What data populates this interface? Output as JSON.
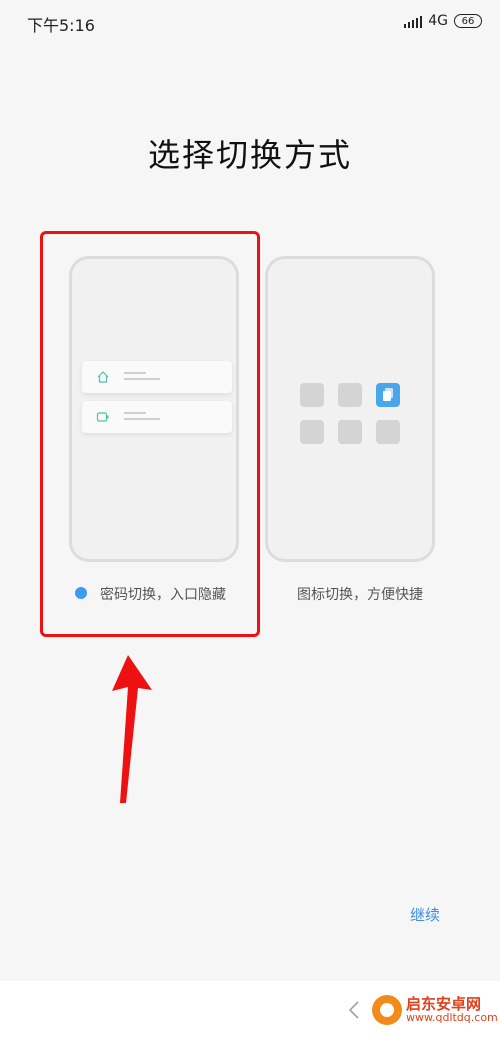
{
  "status_bar": {
    "time": "下午5:16",
    "network": "4G",
    "battery": "66"
  },
  "page": {
    "title": "选择切换方式"
  },
  "options": [
    {
      "label": "密码切换，入口隐藏",
      "selected": true
    },
    {
      "label": "图标切换，方便快捷",
      "selected": false
    }
  ],
  "actions": {
    "continue_label": "继续"
  },
  "watermark": {
    "name": "启东安卓网",
    "url": "www.qdltdq.com"
  },
  "colors": {
    "accent": "#3a9cf0",
    "highlight": "#ee1111",
    "active_tile": "#4aa6ea"
  }
}
